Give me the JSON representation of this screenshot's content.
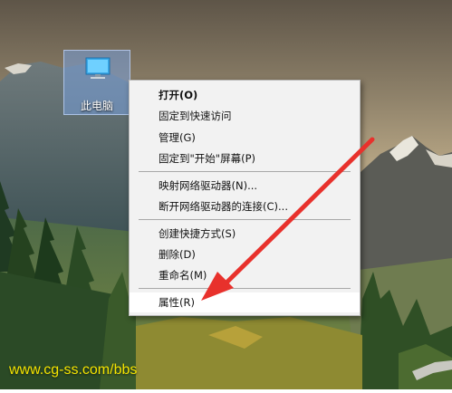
{
  "desktop_icon": {
    "label": "此电脑",
    "icon": "computer-monitor-icon"
  },
  "context_menu": {
    "items": [
      {
        "label": "打开(O)"
      },
      {
        "label": "固定到快速访问"
      },
      {
        "label": "管理(G)"
      },
      {
        "label": "固定到\"开始\"屏幕(P)"
      },
      {
        "label": "映射网络驱动器(N)..."
      },
      {
        "label": "断开网络驱动器的连接(C)..."
      },
      {
        "label": "创建快捷方式(S)"
      },
      {
        "label": "删除(D)"
      },
      {
        "label": "重命名(M)"
      },
      {
        "label": "属性(R)"
      }
    ]
  },
  "annotation": {
    "arrow_color": "#e8312c",
    "arrow_icon": "red-pointer-arrow"
  },
  "watermark": {
    "text": "www.cg-ss.com/bbs",
    "color": "#f5e400"
  }
}
